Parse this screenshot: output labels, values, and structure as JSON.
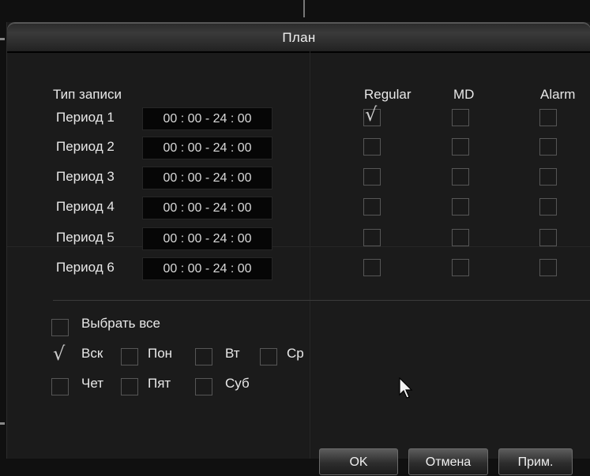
{
  "dialog": {
    "title": "План"
  },
  "record_type_label": "Тип записи",
  "columns": {
    "regular": "Regular",
    "md": "MD",
    "alarm": "Alarm"
  },
  "periods": [
    {
      "label": "Период 1",
      "time": "00 : 00 - 24 : 00",
      "regular": true,
      "md": false,
      "alarm": false
    },
    {
      "label": "Период 2",
      "time": "00 : 00 - 24 : 00",
      "regular": false,
      "md": false,
      "alarm": false
    },
    {
      "label": "Период 3",
      "time": "00 : 00 - 24 : 00",
      "regular": false,
      "md": false,
      "alarm": false
    },
    {
      "label": "Период 4",
      "time": "00 : 00 - 24 : 00",
      "regular": false,
      "md": false,
      "alarm": false
    },
    {
      "label": "Период 5",
      "time": "00 : 00 - 24 : 00",
      "regular": false,
      "md": false,
      "alarm": false
    },
    {
      "label": "Период 6",
      "time": "00 : 00 - 24 : 00",
      "regular": false,
      "md": false,
      "alarm": false
    }
  ],
  "select_all": {
    "label": "Выбрать все",
    "checked": false
  },
  "days": [
    {
      "label": "Вск",
      "checked": true
    },
    {
      "label": "Пон",
      "checked": false
    },
    {
      "label": "Вт",
      "checked": false
    },
    {
      "label": "Ср",
      "checked": false
    },
    {
      "label": "Чет",
      "checked": false
    },
    {
      "label": "Пят",
      "checked": false
    },
    {
      "label": "Суб",
      "checked": false
    }
  ],
  "buttons": {
    "ok": "OK",
    "cancel": "Отмена",
    "apply": "Прим."
  },
  "check_glyph": "√"
}
